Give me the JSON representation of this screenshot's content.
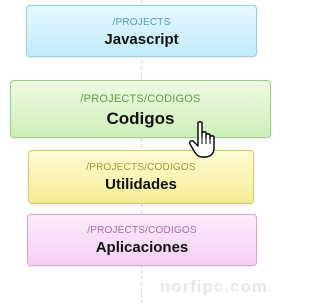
{
  "cards": [
    {
      "path": "/PROJECTS",
      "name": "Javascript"
    },
    {
      "path": "/PROJECTS/CODIGOS",
      "name": "Codigos"
    },
    {
      "path": "/PROJECTS/CODIGOS",
      "name": "Utilidades"
    },
    {
      "path": "/PROJECTS/CODIGOS",
      "name": "Aplicaciones"
    }
  ],
  "cursor": "hand-pointer-icon",
  "watermark": "norfipc.com",
  "colors": {
    "javascript": "#c2eaf8",
    "codigos": "#cfeeba",
    "utilidades": "#f6eb95",
    "aplicaciones": "#f3cff3"
  }
}
